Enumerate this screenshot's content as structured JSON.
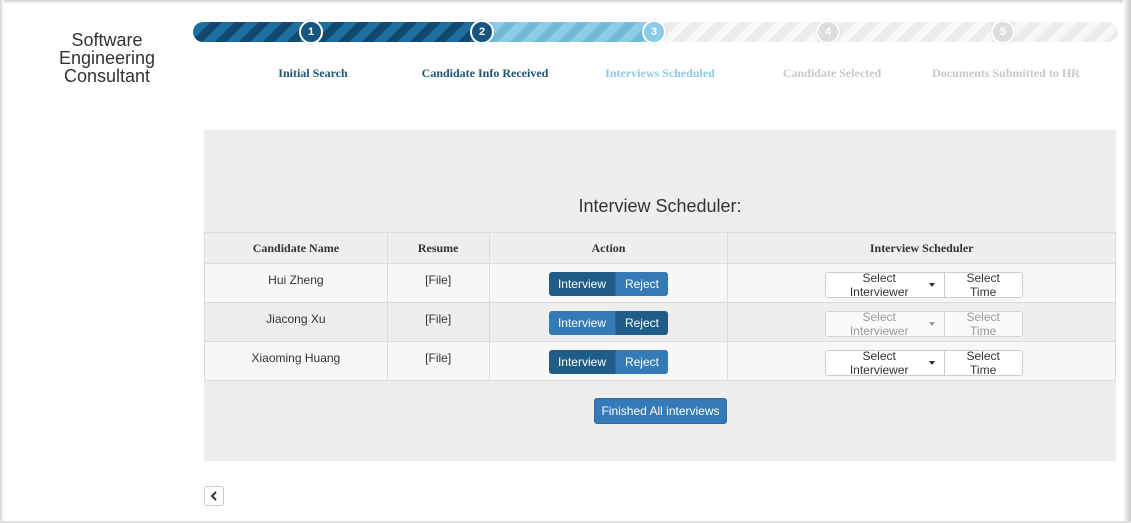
{
  "app": {
    "title_lines": [
      "Software",
      "Engineering",
      "Consultant"
    ]
  },
  "steps": [
    {
      "number": "1",
      "label": "Initial Search",
      "state": "done"
    },
    {
      "number": "2",
      "label": "Candidate Info Received",
      "state": "done"
    },
    {
      "number": "3",
      "label": "Interviews Scheduled",
      "state": "current"
    },
    {
      "number": "4",
      "label": "Candidate Selected",
      "state": "todo"
    },
    {
      "number": "5",
      "label": "Documents Submitted to HR",
      "state": "todo"
    }
  ],
  "scheduler": {
    "title": "Interview Scheduler:",
    "columns": [
      "Candidate Name",
      "Resume",
      "Action",
      "Interview Scheduler"
    ],
    "rows": [
      {
        "name": "Hui Zheng",
        "resume": "[File]",
        "interview_label": "Interview",
        "reject_label": "Reject",
        "interviewer_label": "Select Interviewer",
        "time_label": "Select Time",
        "scheduler_enabled": true
      },
      {
        "name": "Jiacong Xu",
        "resume": "[File]",
        "interview_label": "Interview",
        "reject_label": "Reject",
        "interviewer_label": "Select Interviewer",
        "time_label": "Select Time",
        "scheduler_enabled": false
      },
      {
        "name": "Xiaoming Huang",
        "resume": "[File]",
        "interview_label": "Interview",
        "reject_label": "Reject",
        "interviewer_label": "Select Interviewer",
        "time_label": "Select Time",
        "scheduler_enabled": true
      }
    ],
    "finish_label": "Finished All interviews"
  },
  "back_button": {
    "icon": "chevron-left-icon"
  },
  "colors": {
    "accent": "#337ab7",
    "done": "#15557f",
    "current": "#8ccbe7",
    "todo": "#dddddd"
  }
}
